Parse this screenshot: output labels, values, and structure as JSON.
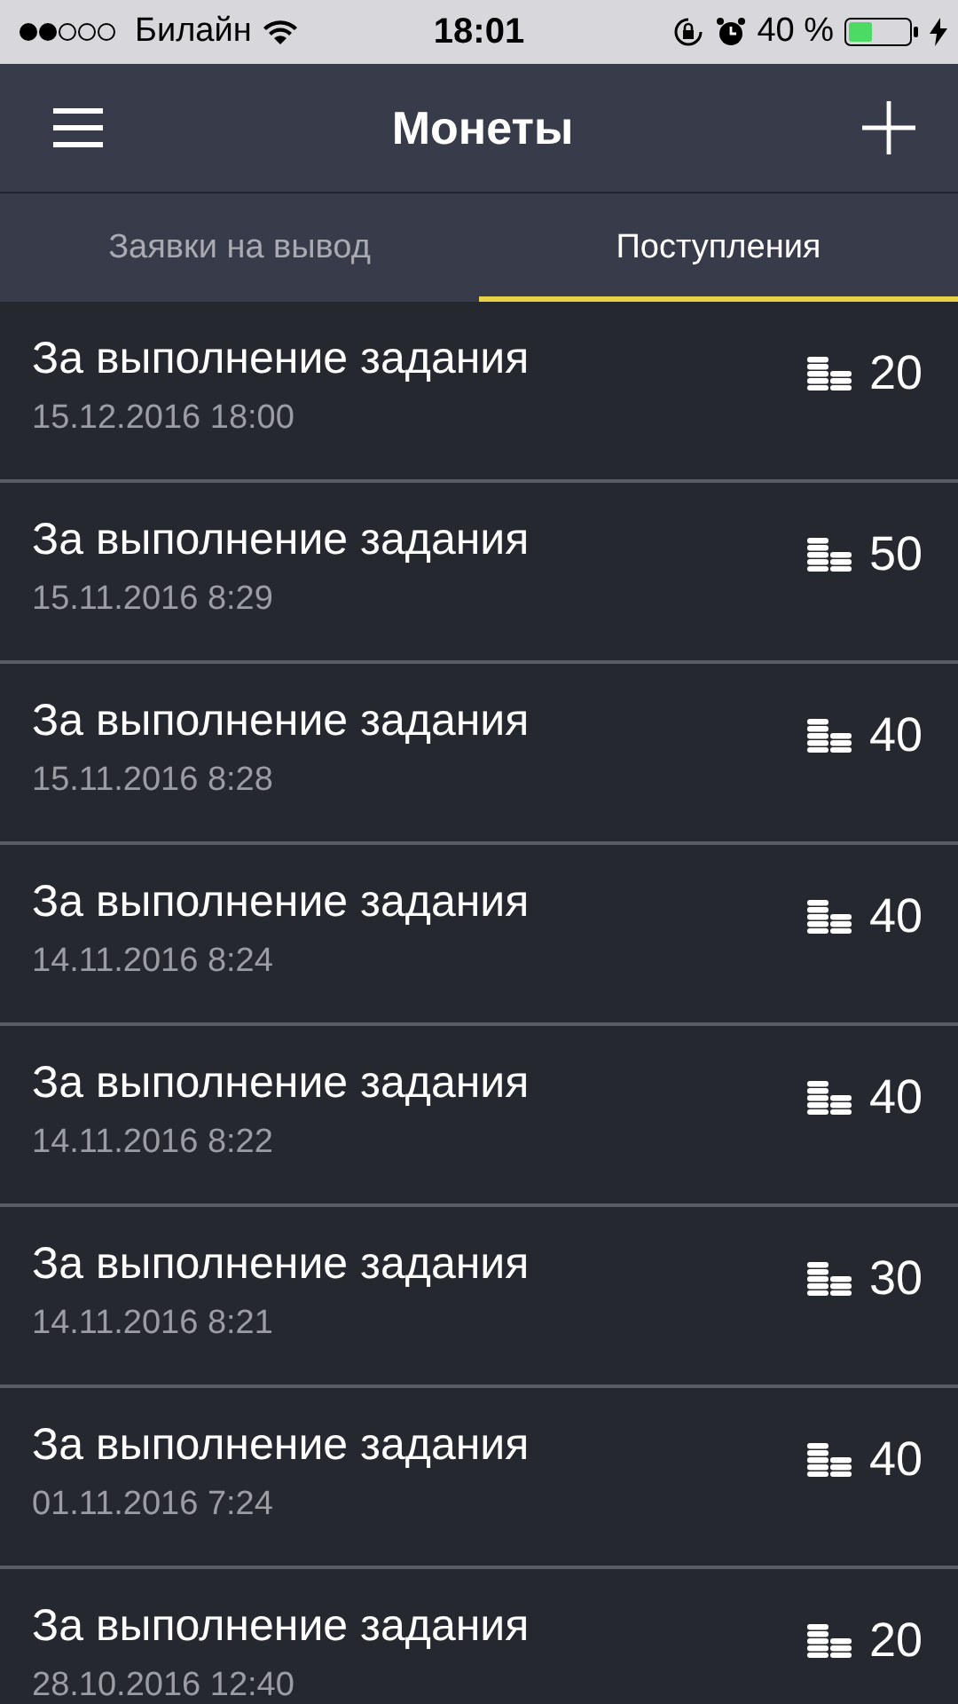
{
  "status_bar": {
    "carrier": "Билайн",
    "time": "18:01",
    "battery": "40 %"
  },
  "nav": {
    "title": "Монеты"
  },
  "tabs": [
    {
      "label": "Заявки на вывод",
      "selected": false
    },
    {
      "label": "Поступления",
      "selected": true
    }
  ],
  "rows": [
    {
      "title": "За выполнение задания",
      "date": "15.12.2016 18:00",
      "amount": "20"
    },
    {
      "title": "За выполнение задания",
      "date": "15.11.2016 8:29",
      "amount": "50"
    },
    {
      "title": "За выполнение задания",
      "date": "15.11.2016 8:28",
      "amount": "40"
    },
    {
      "title": "За выполнение задания",
      "date": "14.11.2016 8:24",
      "amount": "40"
    },
    {
      "title": "За выполнение задания",
      "date": "14.11.2016 8:22",
      "amount": "40"
    },
    {
      "title": "За выполнение задания",
      "date": "14.11.2016 8:21",
      "amount": "30"
    },
    {
      "title": "За выполнение задания",
      "date": "01.11.2016 7:24",
      "amount": "40"
    },
    {
      "title": "За выполнение задания",
      "date": "28.10.2016 12:40",
      "amount": "20"
    }
  ]
}
